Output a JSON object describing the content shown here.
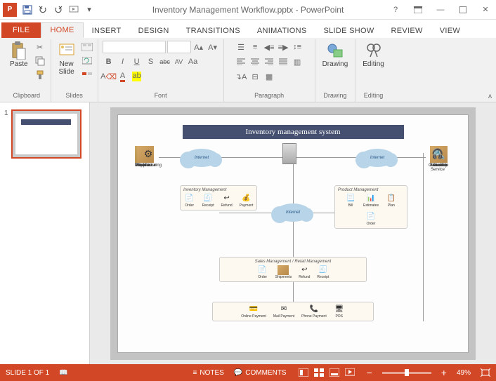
{
  "title": "Inventory Management Workflow.pptx - PowerPoint",
  "tabs": {
    "file": "FILE",
    "home": "HOME",
    "insert": "INSERT",
    "design": "DESIGN",
    "transitions": "TRANSITIONS",
    "animations": "ANIMATIONS",
    "slideshow": "SLIDE SHOW",
    "review": "REVIEW",
    "view": "VIEW"
  },
  "ribbon": {
    "paste": "Paste",
    "clipboard": "Clipboard",
    "newslide": "New\nSlide",
    "slides": "Slides",
    "font": "Font",
    "paragraph": "Paragraph",
    "drawing": "Drawing",
    "editing": "Editing",
    "bold": "B",
    "italic": "I",
    "underline": "U",
    "shadow": "S",
    "strike": "abc",
    "spacing": "AV",
    "clear": "Aᵃ"
  },
  "thumbnail": {
    "num": "1"
  },
  "slide": {
    "banner": "Inventory management system",
    "clouds": {
      "c1": "Internet",
      "c2": "Internet",
      "c3": "Internet"
    },
    "left": {
      "products": "Products",
      "supplier": "Supplier",
      "sales": "Sales",
      "warehouse": "Warehouse",
      "manufacturing": "Manufacturing"
    },
    "right": {
      "inventory": "Inventory",
      "allocation": "Allocation",
      "audit": "Audit",
      "assemble": "Assemble",
      "cs": "Customer Service"
    },
    "box_inv": {
      "title": "Inventory Management",
      "order": "Order",
      "receipt": "Receipt",
      "refund": "Refund",
      "payment": "Payment"
    },
    "box_prod": {
      "title": "Product Management",
      "bill": "Bill",
      "estimates": "Estimates",
      "plan": "Plan",
      "order": "Order"
    },
    "box_sales": {
      "title": "Sales Management / Retail Management",
      "order": "Order",
      "shipments": "Shipments",
      "refund": "Refund",
      "receipt": "Receipt"
    },
    "box_pay": {
      "online": "Online Payment",
      "mail": "Mail Payment",
      "phone": "Phone Payment",
      "pos": "POS"
    }
  },
  "status": {
    "slide": "SLIDE 1 OF 1",
    "notes": "NOTES",
    "comments": "COMMENTS",
    "zoom": "49%"
  }
}
